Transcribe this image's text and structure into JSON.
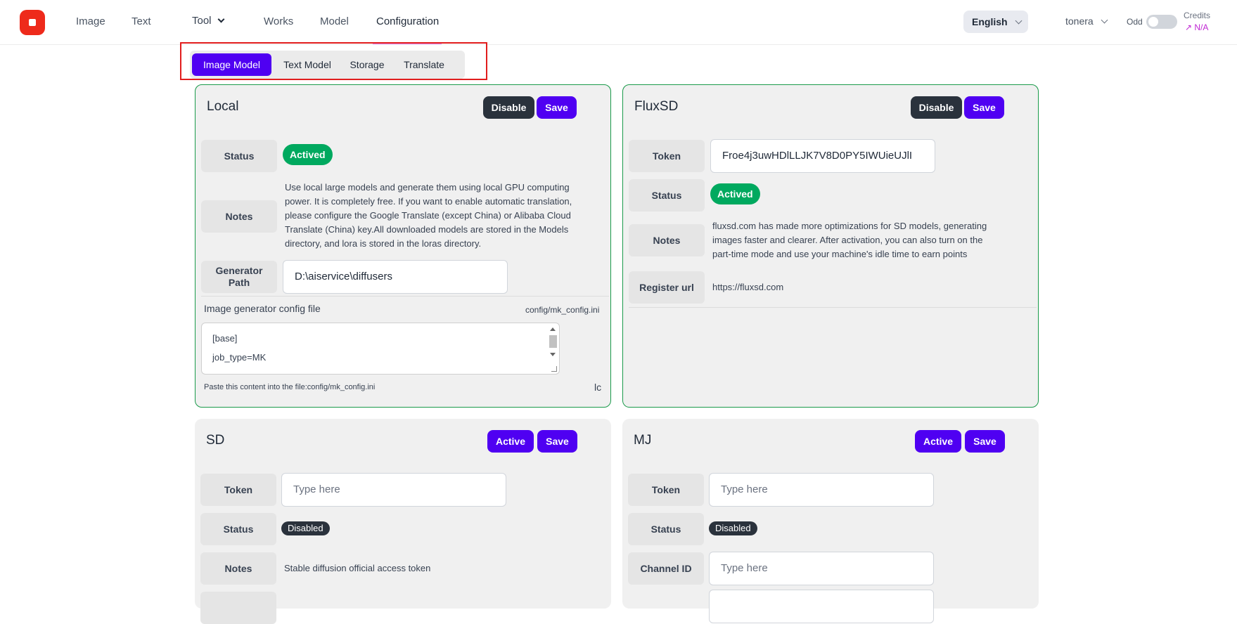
{
  "nav": {
    "links": [
      "Image",
      "Text",
      "Tool",
      "Works",
      "Model",
      "Configuration"
    ],
    "language": "English",
    "user": "tonera",
    "odd_label": "Odd",
    "credits_label": "Credits",
    "credits_value": "↗ N/A"
  },
  "tabs": [
    "Image Model",
    "Text Model",
    "Storage",
    "Translate"
  ],
  "local": {
    "title": "Local",
    "disable_label": "Disable",
    "save_label": "Save",
    "status_label": "Status",
    "status_value": "Actived",
    "notes_label": "Notes",
    "notes_lines": [
      "Use local large models and generate them using local GPU computing",
      "power. It is completely free. If you want to enable automatic translation,",
      "please configure the Google Translate (except China) or Alibaba Cloud",
      "Translate (China) key.All downloaded models are stored in the Models",
      "directory, and lora is stored in the loras directory."
    ],
    "generator_label": "Generator Path",
    "generator_value": "D:\\aiservice\\diffusers",
    "config_label": "Image generator config file",
    "config_path": "config/mk_config.ini",
    "config_lines": [
      "[base]",
      "job_type=MK"
    ],
    "paste_hint": "Paste this content into the file:config/mk_config.ini",
    "copy_icon_text": "lc"
  },
  "fluxsd": {
    "title": "FluxSD",
    "disable_label": "Disable",
    "save_label": "Save",
    "token_label": "Token",
    "token_value": "Froe4j3uwHDlLLJK7V8D0PY5IWUieUJlI",
    "status_label": "Status",
    "status_value": "Actived",
    "notes_label": "Notes",
    "notes_lines": [
      "fluxsd.com has made more optimizations for SD models, generating",
      "images faster and clearer. After activation, you can also turn on the",
      "part-time mode and use your machine's idle time to earn points"
    ],
    "register_label": "Register url",
    "register_value": "https://fluxsd.com"
  },
  "sd": {
    "title": "SD",
    "active_label": "Active",
    "save_label": "Save",
    "token_label": "Token",
    "token_placeholder": "Type here",
    "status_label": "Status",
    "status_value": "Disabled",
    "notes_label": "Notes",
    "notes_value": "Stable diffusion official access token"
  },
  "mj": {
    "title": "MJ",
    "active_label": "Active",
    "save_label": "Save",
    "token_label": "Token",
    "token_placeholder": "Type here",
    "status_label": "Status",
    "status_value": "Disabled",
    "channel_label": "Channel ID",
    "channel_placeholder": "Type here"
  },
  "colors": {
    "brand": "#ee2a1b",
    "accent": "#4f00f2",
    "active_green": "#00a95f",
    "dark_button": "#2a323c",
    "card_border": "#1a9a4a",
    "highlight_box": "#e11d1d"
  }
}
